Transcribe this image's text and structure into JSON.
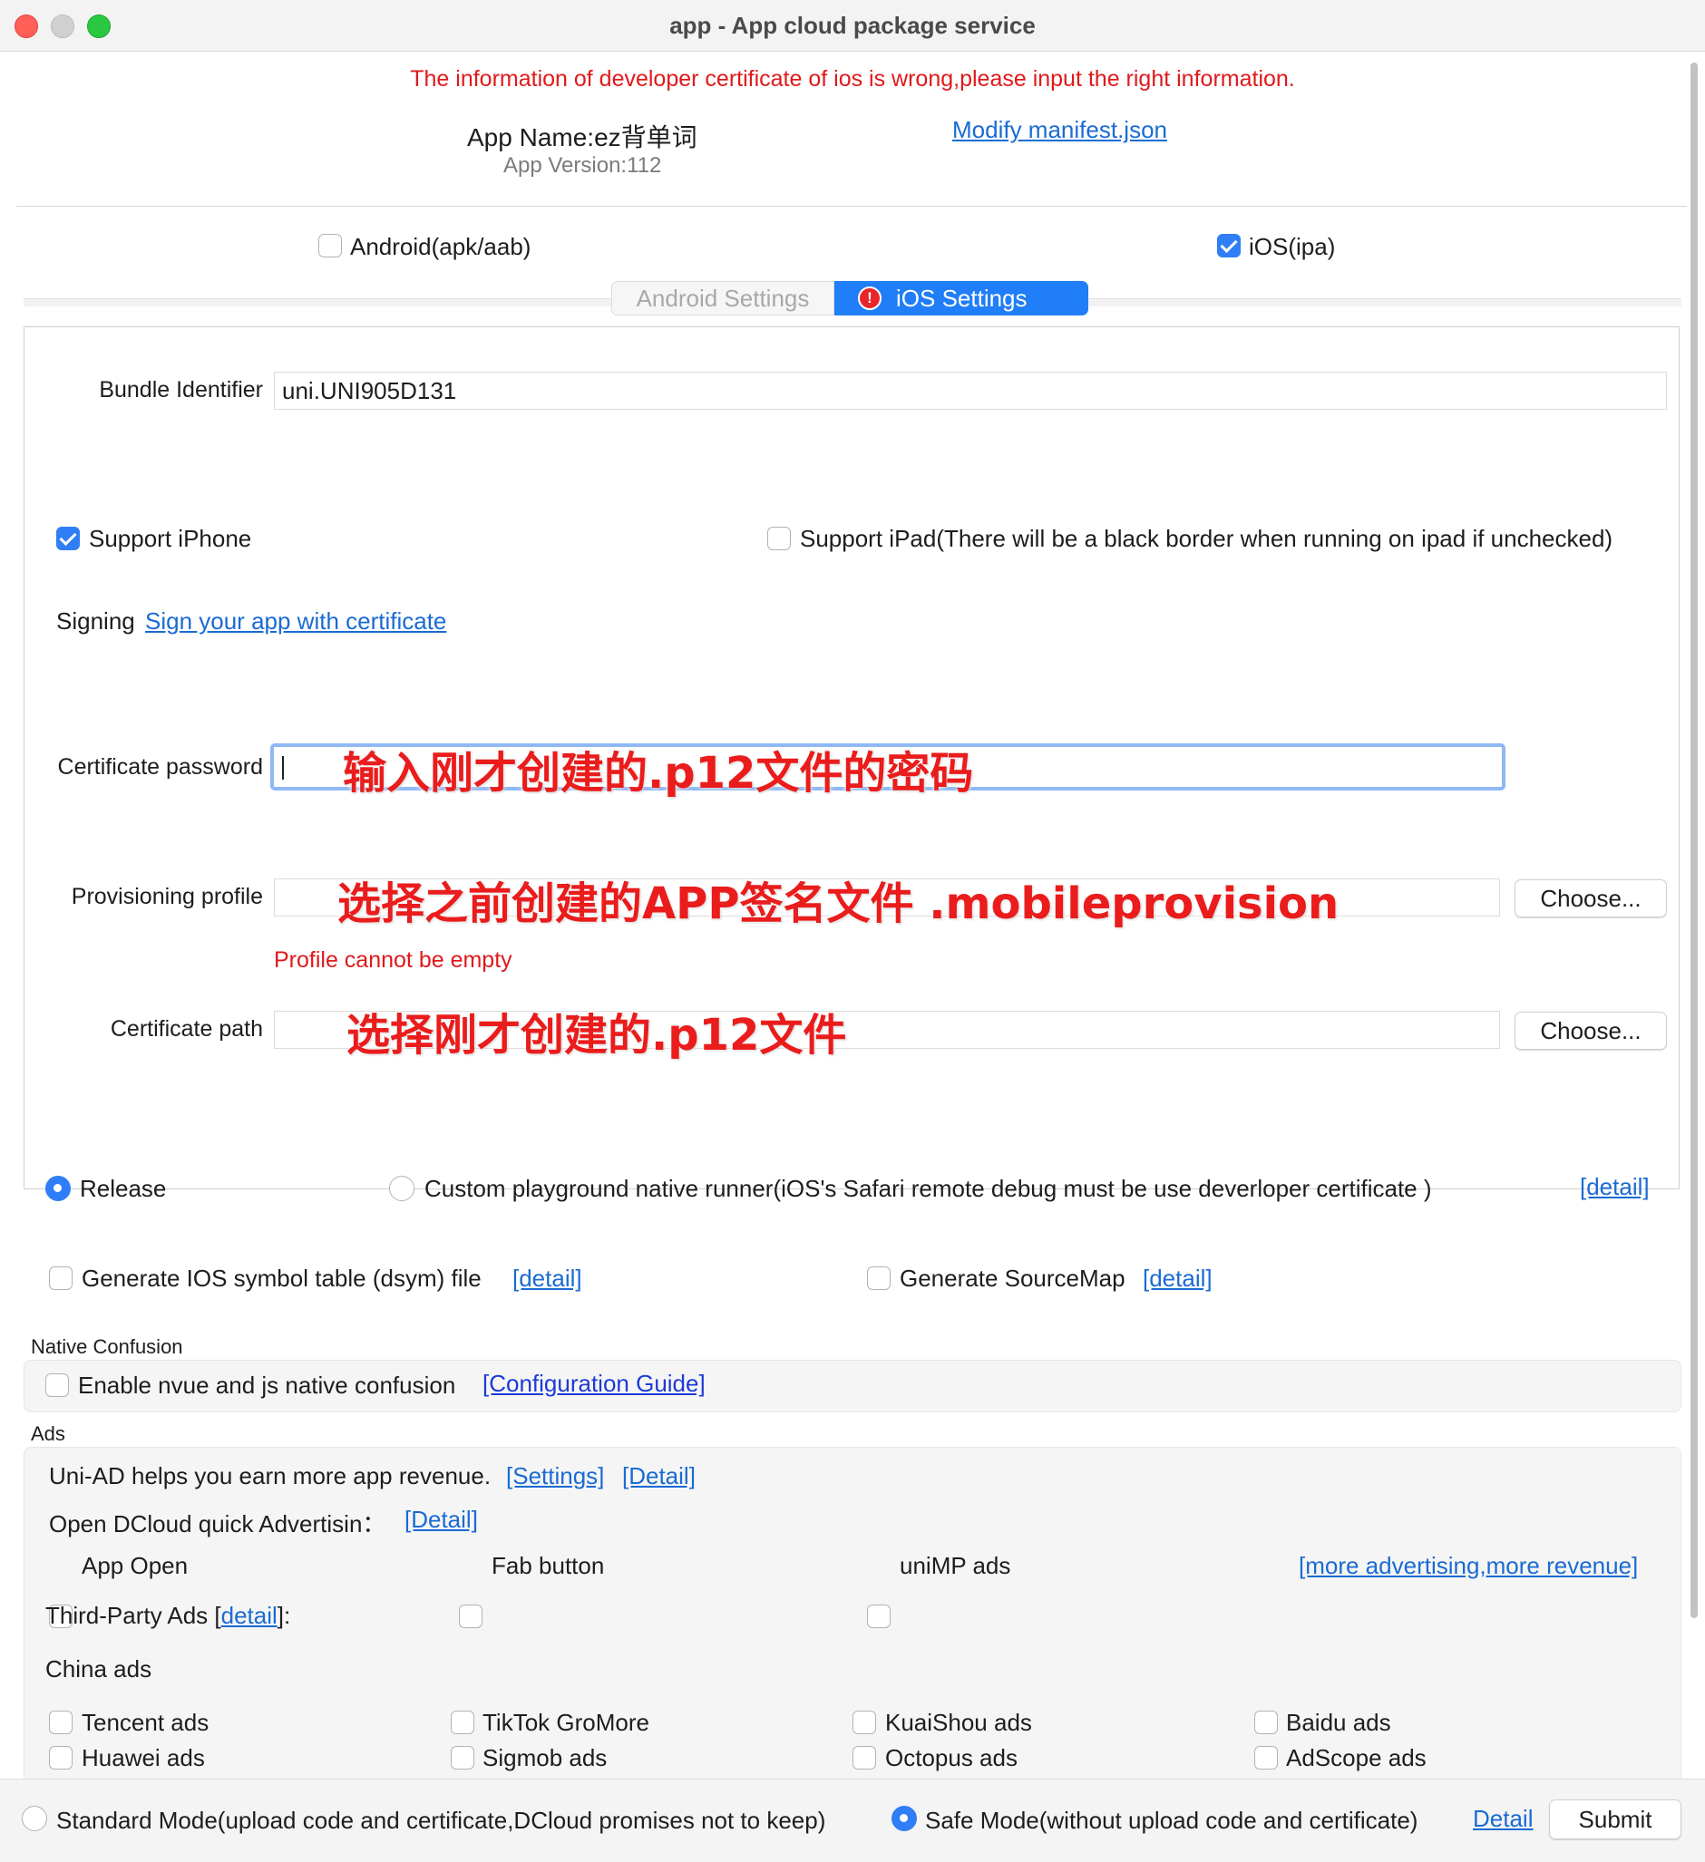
{
  "window": {
    "title": "app - App cloud package service"
  },
  "header": {
    "error_message": "The information of developer certificate of ios is wrong,please input the right information.",
    "app_name": "App Name:ez背单词",
    "app_version": "App Version:112",
    "modify_manifest_link": "Modify manifest.json"
  },
  "platforms": {
    "android_label": "Android(apk/aab)",
    "android_checked": false,
    "ios_label": "iOS(ipa)",
    "ios_checked": true
  },
  "tabs": {
    "android_settings": "Android Settings",
    "ios_settings": "iOS Settings"
  },
  "ios_settings": {
    "bundle_identifier_label": "Bundle Identifier",
    "bundle_identifier_value": "uni.UNI905D131",
    "support_iphone_label": "Support iPhone",
    "support_iphone_checked": true,
    "support_ipad_label": "Support iPad(There will be a black border when running on ipad if unchecked)",
    "support_ipad_checked": false,
    "signing_label": "Signing",
    "signing_link": "Sign your app with certificate",
    "certificate_password_label": "Certificate password",
    "provisioning_profile_label": "Provisioning profile",
    "profile_error": "Profile cannot be empty",
    "certificate_path_label": "Certificate path",
    "choose_button": "Choose..."
  },
  "annotations": {
    "password_hint": "输入刚才创建的.p12文件的密码",
    "profile_hint": "选择之前创建的APP签名文件   .mobileprovision",
    "certificate_hint": "选择刚才创建的.p12文件"
  },
  "build_mode": {
    "release_label": "Release",
    "release_selected": true,
    "custom_runner_label": "Custom playground native runner(iOS's  Safari remote debug must be use deverloper certificate )",
    "custom_runner_selected": false,
    "detail_link": "[detail]"
  },
  "options": {
    "dsym_label": "Generate IOS symbol table (dsym) file",
    "dsym_detail": "[detail]",
    "sourcemap_label": "Generate SourceMap",
    "sourcemap_detail": "[detail]"
  },
  "native_confusion": {
    "group_label": "Native Confusion",
    "enable_label": "Enable nvue and js native confusion",
    "guide_link": "[Configuration Guide]"
  },
  "ads": {
    "group_label": "Ads",
    "uniad_text": "Uni-AD helps you earn more app revenue.",
    "settings_link": "[Settings]",
    "detail_link": "[Detail]",
    "quick_adv_text": "Open DCloud quick Advertisin：",
    "quick_adv_detail": "[Detail]",
    "app_open": "App Open",
    "fab_button": "Fab button",
    "unimp_ads": "uniMP ads",
    "more_link": "[more advertising,more revenue]",
    "third_party_prefix": "Third-Party Ads [",
    "third_party_link": "detail",
    "third_party_suffix": "]:",
    "china_ads_label": "China ads",
    "china_ads": [
      "Tencent ads",
      "TikTok GroMore",
      "KuaiShou ads",
      "Baidu ads",
      "Huawei ads",
      "Sigmob ads",
      "Octopus ads",
      "AdScope ads"
    ]
  },
  "footer": {
    "standard_mode": "Standard Mode(upload code and certificate,DCloud promises not to keep)",
    "standard_selected": false,
    "safe_mode": "Safe Mode(without upload code and certificate)",
    "safe_selected": true,
    "detail_link": "Detail",
    "submit_button": "Submit"
  }
}
